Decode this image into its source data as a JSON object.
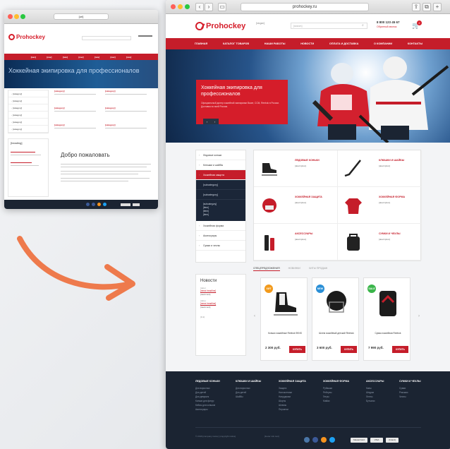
{
  "colors": {
    "accent": "#c51d2a",
    "dark_footer": "#1b2432",
    "page_bg": "#f3f4f6",
    "arrow": "#ee7a4c"
  },
  "old_version": {
    "url": "[url]",
    "logo": "Prohockey",
    "nav": [
      "[nav]",
      "[nav]",
      "[nav]",
      "[nav]",
      "[nav]",
      "[nav]",
      "[nav]"
    ],
    "hero_text": "Хоккейная экипировка для профессионалов",
    "sidebar": [
      "[category]",
      "[category]",
      "[category]",
      "[category]",
      "[category]",
      "[category]"
    ],
    "categories": [
      "[category]",
      "[category]",
      "[category]",
      "[category]",
      "[category]",
      "[category]"
    ],
    "news_title": "[heading]",
    "welcome": "Добро пожаловать"
  },
  "browser": {
    "url": "prohockey.ru"
  },
  "header": {
    "logo": "Prohockey",
    "slogan": "[slogan]",
    "search_placeholder": "[search]",
    "phone": "8 800 123 45 67",
    "callback": "Обратный звонок",
    "cart_count": "2"
  },
  "nav": [
    "ГЛАВНАЯ",
    "КАТАЛОГ ТОВАРОВ",
    "НАШИ РАБОТЫ",
    "НОВОСТИ",
    "ОПЛАТА И ДОСТАВКА",
    "О КОМПАНИИ",
    "КОНТАКТЫ"
  ],
  "hero": {
    "title": "Хоккейная экипировка для профессионалов",
    "text": "Официальный дилер хоккейной экипировки Bauer, CCM, Reebok в России. Доставка по всей России."
  },
  "sidebar": {
    "top": [
      "Ледовые коньки",
      "Клюшки и шайбы"
    ],
    "active": "Хоккейная защита",
    "subs": [
      "[subcategory]",
      "[subcategory]"
    ],
    "sub_group": "[subcategory]",
    "sub_items": [
      "[item]",
      "[item]",
      "[item]"
    ],
    "bottom": [
      "Хоккейная форма",
      "Аксессуары",
      "Сумки и чехлы"
    ]
  },
  "news": {
    "heading": "Новости",
    "items": [
      {
        "date": "[date]",
        "title": "[news headline]",
        "text": "[news text]"
      },
      {
        "date": "[date]",
        "title": "[news headline]",
        "text": "[news text]"
      }
    ],
    "all": "[link]"
  },
  "categories": [
    {
      "title": "ЛЕДОВЫЕ КОНЬКИ",
      "desc": "[description]"
    },
    {
      "title": "КЛЮШКИ И ШАЙБЫ",
      "desc": "[description]"
    },
    {
      "title": "ХОККЕЙНАЯ ЗАЩИТА",
      "desc": "[description]"
    },
    {
      "title": "ХОККЕЙНАЯ ФОРМА",
      "desc": "[description]"
    },
    {
      "title": "АКСЕССУАРЫ",
      "desc": "[description]"
    },
    {
      "title": "СУМКИ И ЧЕХЛЫ",
      "desc": "[description]"
    }
  ],
  "tabs": [
    "СПЕЦПРЕДЛОЖЕНИЯ",
    "НОВИНКИ",
    "ХИТЫ ПРОДАЖ"
  ],
  "products": [
    {
      "badge": "ХИТ",
      "badge_color": "#f29a1c",
      "name": "Коньки хоккейные Reebok 9KNS",
      "price": "2 300 руб.",
      "buy": "КУПИТЬ"
    },
    {
      "badge": "NEW",
      "badge_color": "#2a8fd6",
      "name": "Шлем хоккейный детский Reebok",
      "price": "3 600 руб.",
      "buy": "КУПИТЬ"
    },
    {
      "badge": "SALE",
      "badge_color": "#3ab54a",
      "name": "Сумка хоккейная Reebok",
      "price": "7 990 руб.",
      "buy": "КУПИТЬ"
    }
  ],
  "footer": {
    "columns": [
      {
        "title": "ЛЕДОВЫЕ КОНЬКИ",
        "links": [
          "Для взрослых",
          "Для детей",
          "Для девушек",
          "Коньки для фигур",
          "Кейсы для коньков",
          "Аксессуары"
        ]
      },
      {
        "title": "КЛЮШКИ И ШАЙБЫ",
        "links": [
          "Для взрослых",
          "Для детей",
          "Шайбы"
        ]
      },
      {
        "title": "ХОККЕЙНАЯ ЗАЩИТА",
        "links": [
          "Защита",
          "Налокотники",
          "Нагрудники",
          "Шорты",
          "Шлемы",
          "Перчатки"
        ]
      },
      {
        "title": "ХОККЕЙНАЯ ФОРМА",
        "links": [
          "Рубашки",
          "Рейтузы",
          "Гетры",
          "Майки"
        ]
      },
      {
        "title": "АКСЕССУАРЫ",
        "links": [
          "Капы",
          "Шнурки",
          "Ленты",
          "Бутылки"
        ]
      },
      {
        "title": "СУМКИ И ЧЕХЛЫ",
        "links": [
          "Сумки",
          "Рюкзаки",
          "Чехлы"
        ]
      }
    ],
    "copyright": "© 2016 [company name]. [copyright notice]",
    "info": "[footer info text]",
    "payments": [
      "MasterCard",
      "VISA",
      "[brand]"
    ]
  }
}
